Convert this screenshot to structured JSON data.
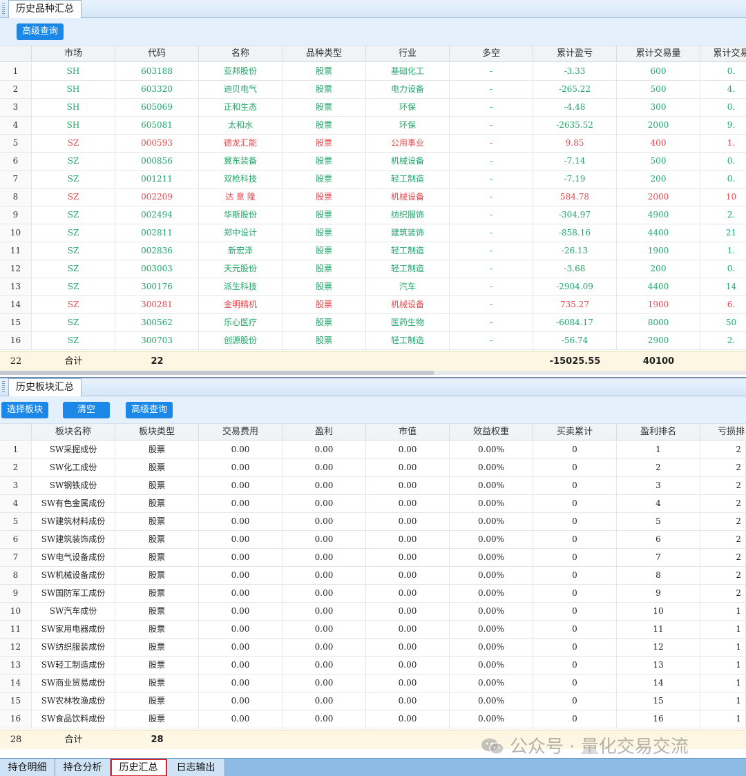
{
  "colors": {
    "accent": "#1b87e6",
    "up": "#e5484d",
    "down": "#20a66a",
    "summary_bg": "#fdf6e2"
  },
  "panel1": {
    "tab_label": "历史品种汇总",
    "buttons": {
      "advanced_query": "高级查询"
    },
    "columns": [
      "",
      "市场",
      "代码",
      "名称",
      "品种类型",
      "行业",
      "多空",
      "累计盈亏",
      "累计交易量",
      "累计交易"
    ],
    "rows": [
      {
        "n": "1",
        "market": "SH",
        "code": "603188",
        "name": "亚邦股份",
        "type": "股票",
        "industry": "基础化工",
        "side": "-",
        "pnl": "-3.33",
        "volume": "600",
        "amt": "0.",
        "color": "g"
      },
      {
        "n": "2",
        "market": "SH",
        "code": "603320",
        "name": "迪贝电气",
        "type": "股票",
        "industry": "电力设备",
        "side": "-",
        "pnl": "-265.22",
        "volume": "500",
        "amt": "4.",
        "color": "g"
      },
      {
        "n": "3",
        "market": "SH",
        "code": "605069",
        "name": "正和生态",
        "type": "股票",
        "industry": "环保",
        "side": "-",
        "pnl": "-4.48",
        "volume": "300",
        "amt": "0.",
        "color": "g"
      },
      {
        "n": "4",
        "market": "SH",
        "code": "605081",
        "name": "太和水",
        "type": "股票",
        "industry": "环保",
        "side": "-",
        "pnl": "-2635.52",
        "volume": "2000",
        "amt": "9.",
        "color": "g"
      },
      {
        "n": "5",
        "market": "SZ",
        "code": "000593",
        "name": "德龙汇能",
        "type": "股票",
        "industry": "公用事业",
        "side": "-",
        "pnl": "9.85",
        "volume": "400",
        "amt": "1.",
        "color": "r"
      },
      {
        "n": "6",
        "market": "SZ",
        "code": "000856",
        "name": "冀东装备",
        "type": "股票",
        "industry": "机械设备",
        "side": "-",
        "pnl": "-7.14",
        "volume": "500",
        "amt": "0.",
        "color": "g"
      },
      {
        "n": "7",
        "market": "SZ",
        "code": "001211",
        "name": "双枪科技",
        "type": "股票",
        "industry": "轻工制造",
        "side": "-",
        "pnl": "-7.19",
        "volume": "200",
        "amt": "0.",
        "color": "g"
      },
      {
        "n": "8",
        "market": "SZ",
        "code": "002209",
        "name": "达 意 隆",
        "type": "股票",
        "industry": "机械设备",
        "side": "-",
        "pnl": "584.78",
        "volume": "2000",
        "amt": "10",
        "color": "r"
      },
      {
        "n": "9",
        "market": "SZ",
        "code": "002494",
        "name": "华斯股份",
        "type": "股票",
        "industry": "纺织服饰",
        "side": "-",
        "pnl": "-304.97",
        "volume": "4900",
        "amt": "2.",
        "color": "g"
      },
      {
        "n": "10",
        "market": "SZ",
        "code": "002811",
        "name": "郑中设计",
        "type": "股票",
        "industry": "建筑装饰",
        "side": "-",
        "pnl": "-858.16",
        "volume": "4400",
        "amt": "21",
        "color": "g"
      },
      {
        "n": "11",
        "market": "SZ",
        "code": "002836",
        "name": "新宏泽",
        "type": "股票",
        "industry": "轻工制造",
        "side": "-",
        "pnl": "-26.13",
        "volume": "1900",
        "amt": "1.",
        "color": "g"
      },
      {
        "n": "12",
        "market": "SZ",
        "code": "003003",
        "name": "天元股份",
        "type": "股票",
        "industry": "轻工制造",
        "side": "-",
        "pnl": "-3.68",
        "volume": "200",
        "amt": "0.",
        "color": "g"
      },
      {
        "n": "13",
        "market": "SZ",
        "code": "300176",
        "name": "派生科技",
        "type": "股票",
        "industry": "汽车",
        "side": "-",
        "pnl": "-2904.09",
        "volume": "4400",
        "amt": "14",
        "color": "g"
      },
      {
        "n": "14",
        "market": "SZ",
        "code": "300281",
        "name": "金明精机",
        "type": "股票",
        "industry": "机械设备",
        "side": "-",
        "pnl": "735.27",
        "volume": "1900",
        "amt": "6.",
        "color": "r"
      },
      {
        "n": "15",
        "market": "SZ",
        "code": "300562",
        "name": "乐心医疗",
        "type": "股票",
        "industry": "医药生物",
        "side": "-",
        "pnl": "-6084.17",
        "volume": "8000",
        "amt": "50",
        "color": "g"
      },
      {
        "n": "16",
        "market": "SZ",
        "code": "300703",
        "name": "创源股份",
        "type": "股票",
        "industry": "轻工制造",
        "side": "-",
        "pnl": "-56.74",
        "volume": "2900",
        "amt": "2.",
        "color": "g"
      }
    ],
    "summary": {
      "count": "22",
      "label": "合计",
      "code_count": "22",
      "pnl": "-15025.55",
      "volume": "40100"
    }
  },
  "panel2": {
    "tab_label": "历史板块汇总",
    "buttons": {
      "select_sector": "选择板块",
      "clear": "清空",
      "advanced_query": "高级查询"
    },
    "columns": [
      "",
      "板块名称",
      "板块类型",
      "交易费用",
      "盈利",
      "市值",
      "效益权重",
      "买卖累计",
      "盈利排名",
      "亏损排"
    ],
    "rows": [
      {
        "n": "1",
        "name": "SW采掘成份",
        "type": "股票",
        "fee": "0.00",
        "profit": "0.00",
        "mv": "0.00",
        "weight": "0.00%",
        "trades": "0",
        "rank": "1",
        "loss": "2"
      },
      {
        "n": "2",
        "name": "SW化工成份",
        "type": "股票",
        "fee": "0.00",
        "profit": "0.00",
        "mv": "0.00",
        "weight": "0.00%",
        "trades": "0",
        "rank": "2",
        "loss": "2"
      },
      {
        "n": "3",
        "name": "SW钢铁成份",
        "type": "股票",
        "fee": "0.00",
        "profit": "0.00",
        "mv": "0.00",
        "weight": "0.00%",
        "trades": "0",
        "rank": "3",
        "loss": "2"
      },
      {
        "n": "4",
        "name": "SW有色金属成份",
        "type": "股票",
        "fee": "0.00",
        "profit": "0.00",
        "mv": "0.00",
        "weight": "0.00%",
        "trades": "0",
        "rank": "4",
        "loss": "2"
      },
      {
        "n": "5",
        "name": "SW建筑材料成份",
        "type": "股票",
        "fee": "0.00",
        "profit": "0.00",
        "mv": "0.00",
        "weight": "0.00%",
        "trades": "0",
        "rank": "5",
        "loss": "2"
      },
      {
        "n": "6",
        "name": "SW建筑装饰成份",
        "type": "股票",
        "fee": "0.00",
        "profit": "0.00",
        "mv": "0.00",
        "weight": "0.00%",
        "trades": "0",
        "rank": "6",
        "loss": "2"
      },
      {
        "n": "7",
        "name": "SW电气设备成份",
        "type": "股票",
        "fee": "0.00",
        "profit": "0.00",
        "mv": "0.00",
        "weight": "0.00%",
        "trades": "0",
        "rank": "7",
        "loss": "2"
      },
      {
        "n": "8",
        "name": "SW机械设备成份",
        "type": "股票",
        "fee": "0.00",
        "profit": "0.00",
        "mv": "0.00",
        "weight": "0.00%",
        "trades": "0",
        "rank": "8",
        "loss": "2"
      },
      {
        "n": "9",
        "name": "SW国防军工成份",
        "type": "股票",
        "fee": "0.00",
        "profit": "0.00",
        "mv": "0.00",
        "weight": "0.00%",
        "trades": "0",
        "rank": "9",
        "loss": "2"
      },
      {
        "n": "10",
        "name": "SW汽车成份",
        "type": "股票",
        "fee": "0.00",
        "profit": "0.00",
        "mv": "0.00",
        "weight": "0.00%",
        "trades": "0",
        "rank": "10",
        "loss": "1"
      },
      {
        "n": "11",
        "name": "SW家用电器成份",
        "type": "股票",
        "fee": "0.00",
        "profit": "0.00",
        "mv": "0.00",
        "weight": "0.00%",
        "trades": "0",
        "rank": "11",
        "loss": "1"
      },
      {
        "n": "12",
        "name": "SW纺织服装成份",
        "type": "股票",
        "fee": "0.00",
        "profit": "0.00",
        "mv": "0.00",
        "weight": "0.00%",
        "trades": "0",
        "rank": "12",
        "loss": "1"
      },
      {
        "n": "13",
        "name": "SW轻工制造成份",
        "type": "股票",
        "fee": "0.00",
        "profit": "0.00",
        "mv": "0.00",
        "weight": "0.00%",
        "trades": "0",
        "rank": "13",
        "loss": "1"
      },
      {
        "n": "14",
        "name": "SW商业贸易成份",
        "type": "股票",
        "fee": "0.00",
        "profit": "0.00",
        "mv": "0.00",
        "weight": "0.00%",
        "trades": "0",
        "rank": "14",
        "loss": "1"
      },
      {
        "n": "15",
        "name": "SW农林牧渔成份",
        "type": "股票",
        "fee": "0.00",
        "profit": "0.00",
        "mv": "0.00",
        "weight": "0.00%",
        "trades": "0",
        "rank": "15",
        "loss": "1"
      },
      {
        "n": "16",
        "name": "SW食品饮料成份",
        "type": "股票",
        "fee": "0.00",
        "profit": "0.00",
        "mv": "0.00",
        "weight": "0.00%",
        "trades": "0",
        "rank": "16",
        "loss": "1"
      }
    ],
    "summary": {
      "count": "28",
      "label": "合计",
      "name_count": "28"
    }
  },
  "bottom_tabs": [
    {
      "label": "持仓明细",
      "active": false
    },
    {
      "label": "持仓分析",
      "active": false
    },
    {
      "label": "历史汇总",
      "active": true
    },
    {
      "label": "日志输出",
      "active": false
    }
  ],
  "watermark": {
    "text": "公众号 · 量化交易交流",
    "icon": "wechat-icon"
  }
}
